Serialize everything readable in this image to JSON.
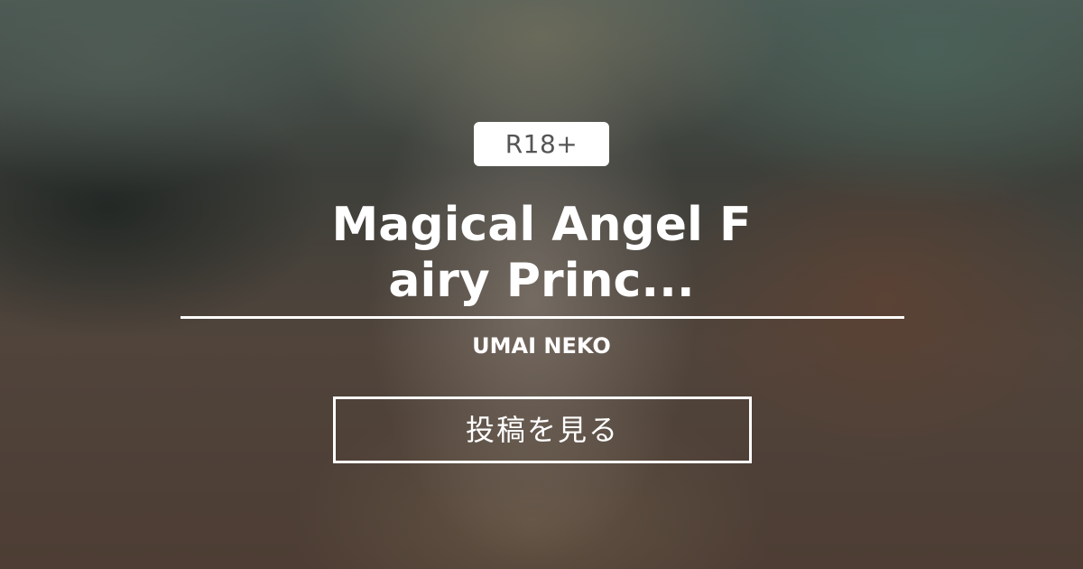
{
  "badge": {
    "label": "R18+"
  },
  "post": {
    "title_line1": "Magical Angel F",
    "title_line2": "airy Princ...",
    "author": "UMAI NEKO"
  },
  "cta": {
    "label": "投稿を見る"
  },
  "colors": {
    "badge_bg": "#ffffff",
    "badge_text": "#555555",
    "text": "#ffffff"
  }
}
